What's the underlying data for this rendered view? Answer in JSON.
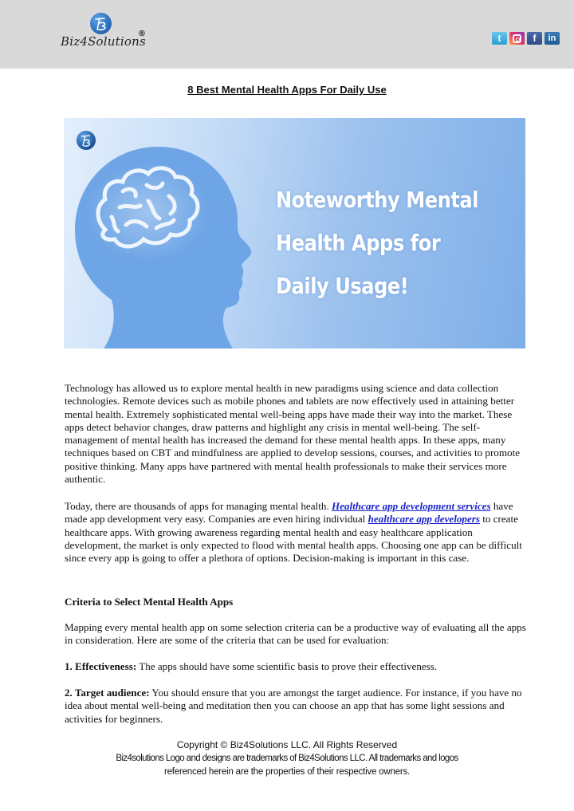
{
  "header": {
    "brand_name": "Biz4Solutions",
    "registered_mark": "®",
    "logo_icon": "b-monogram-globe",
    "social_icons": [
      {
        "name": "twitter",
        "glyph": "t"
      },
      {
        "name": "instagram",
        "glyph": ""
      },
      {
        "name": "facebook",
        "glyph": "f"
      },
      {
        "name": "linkedin",
        "glyph": "in"
      }
    ]
  },
  "document": {
    "title": "8 Best Mental Health Apps For Daily Use",
    "banner": {
      "lines": [
        "Noteworthy Mental",
        "Health Apps for",
        "Daily Usage!"
      ],
      "colors": {
        "text": "#ffffff",
        "head": "#6fa6e6"
      }
    },
    "paragraph_1": "Technology has allowed us to explore mental health in new paradigms using science and data collection technologies. Remote devices such as mobile phones and tablets are now effectively used in attaining better mental health. Extremely sophisticated mental well-being apps have made their way into the market. These apps detect behavior changes, draw patterns and highlight any crisis in mental well-being. The self-management of mental health has increased the demand for these mental health apps. In these apps, many techniques based on CBT and mindfulness are applied to develop sessions, courses, and activities to promote positive thinking. Many apps have partnered with mental health professionals to make their services more authentic.",
    "paragraph_2": {
      "part_1": "Today, there are thousands of apps for managing mental health. ",
      "link_1": "Healthcare app development services",
      "part_2": " have made app development very easy. Companies are even hiring individual ",
      "link_2": "healthcare app developers",
      "part_3": " to create healthcare apps. With growing awareness regarding mental health and easy healthcare application development, the market is only expected to flood with mental health apps. Choosing one app can be difficult since every app is going to offer a plethora of options. Decision-making is important in this case."
    },
    "section_heading": "Criteria to Select Mental Health Apps",
    "paragraph_3": "Mapping every mental health app on some selection criteria can be a productive way of evaluating all the apps in consideration. Here are some of the criteria that can be used for evaluation:",
    "criteria": [
      {
        "label": "1. Effectiveness:",
        "text": " The apps should have some scientific basis to prove their effectiveness."
      },
      {
        "label": "2. Target audience:",
        "text": " You should ensure that you are amongst the target audience. For instance, if you have no idea about mental well-being and meditation then you can choose an app that has some light sessions and activities for beginners."
      }
    ],
    "link_color": "#1a22c9"
  },
  "footer": {
    "line_1": "Copyright © Biz4Solutions LLC. All Rights Reserved",
    "line_2": "Biz4solutions Logo and designs are trademarks of Biz4Solutions LLC. All trademarks and logos",
    "line_3": "referenced herein are the properties of their respective owners."
  }
}
